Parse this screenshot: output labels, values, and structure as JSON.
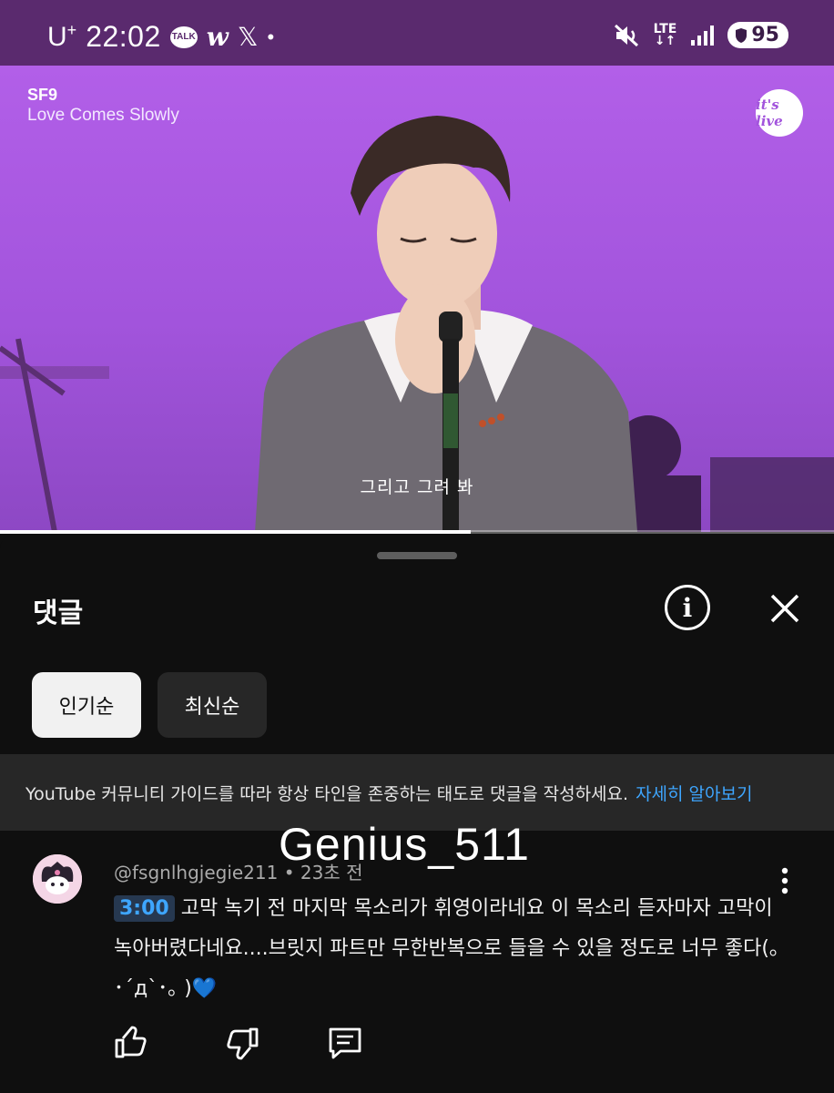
{
  "status_bar": {
    "carrier": "U",
    "carrier_sup": "+",
    "time": "22:02",
    "talk_badge": "TALK",
    "w_icon_text": "w",
    "x_icon_text": "𝕏",
    "dot": "•",
    "network": "LTE",
    "battery": "95"
  },
  "video": {
    "artist": "SF9",
    "song": "Love Comes Slowly",
    "logo": "it's live",
    "subtitle": "그리고 그려 봐",
    "progress_fraction": 0.564,
    "background_color": "#a254dc"
  },
  "comments_sheet": {
    "title": "댓글",
    "info_icon": "i",
    "sort_chips": [
      {
        "label": "인기순",
        "selected": true
      },
      {
        "label": "최신순",
        "selected": false
      }
    ],
    "guideline_text": "YouTube 커뮤니티 가이드를 따라 항상 타인을 존중하는 태도로 댓글을 작성하세요.",
    "guideline_link": "자세히 알아보기"
  },
  "watermark": "Genius_511",
  "comment": {
    "author": "@fsgnlhgjegie211",
    "separator": " • ",
    "time_ago": "23초 전",
    "timestamp": "3:00",
    "text": " 고막 녹기 전 마지막 목소리가 휘영이라네요 이 목소리 듣자마자 고막이 녹아버렸다네요....브릿지 파트만 무한반복으로 들을 수 있을 정도로 너무 좋다(｡ ･´д`･｡ )💙"
  },
  "colors": {
    "accent_link": "#3ea6ff",
    "sheet_bg": "#0f0f0f",
    "status_bg": "#5a2a6e"
  }
}
